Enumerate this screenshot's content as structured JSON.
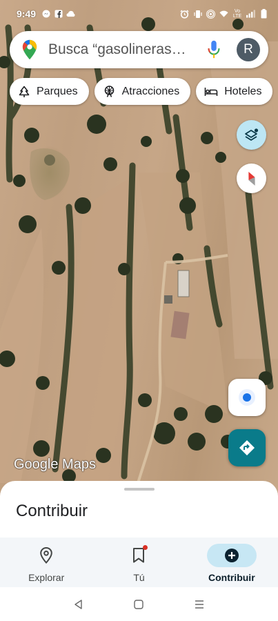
{
  "status_bar": {
    "time": "9:49",
    "left_icons": [
      "messenger-icon",
      "facebook-icon",
      "cloud-icon"
    ],
    "right_icons": [
      "alarm-icon",
      "vibrate-icon",
      "hotspot-icon",
      "wifi-icon",
      "volte-icon",
      "signal-icon",
      "battery-icon"
    ],
    "volte_label": "Vo\nLTE"
  },
  "search": {
    "placeholder": "Busca “gasolineras…",
    "avatar_initial": "R"
  },
  "chips": [
    {
      "label": "Parques",
      "icon": "tree-icon"
    },
    {
      "label": "Atracciones",
      "icon": "ferris-wheel-icon"
    },
    {
      "label": "Hoteles",
      "icon": "bed-icon"
    }
  ],
  "map": {
    "watermark": "Google Maps"
  },
  "sheet": {
    "title": "Contribuir"
  },
  "bottom_nav": {
    "items": [
      {
        "label": "Explorar",
        "icon": "pin-icon",
        "active": false
      },
      {
        "label": "Tú",
        "icon": "bookmark-icon",
        "active": false,
        "badge": true
      },
      {
        "label": "Contribuir",
        "icon": "add-circle-icon",
        "active": true
      }
    ]
  },
  "colors": {
    "accent_teal": "#0a7b8a",
    "layers_bg": "#bde6f4",
    "active_pill": "#c7e7f4",
    "location_dot": "#1a73e8"
  }
}
